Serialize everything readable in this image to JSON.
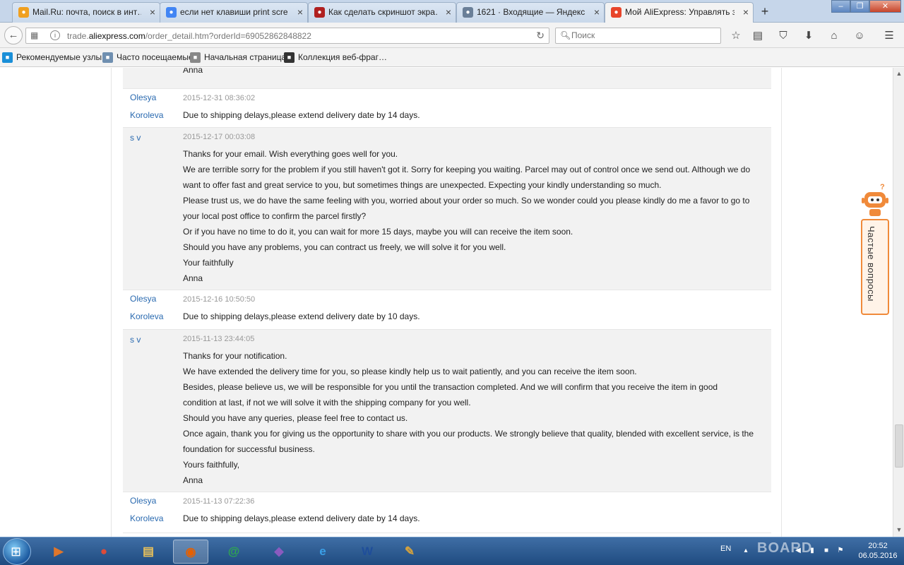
{
  "browser": {
    "tabs": [
      {
        "label": "Mail.Ru: почта, поиск в инт…",
        "icon": "mailru-icon",
        "color": "#f0a020"
      },
      {
        "label": "если нет клавиши print scre…",
        "icon": "google-icon",
        "color": "#4285f4"
      },
      {
        "label": "Как сделать скриншот экра…",
        "icon": "site-icon",
        "color": "#b02020"
      },
      {
        "label": "1621 · Входящие — Яндекс…",
        "icon": "mail-icon",
        "color": "#6a7f98"
      },
      {
        "label": "Мой AliExpress: Управлять з…",
        "icon": "aliexpress-icon",
        "color": "#e8452b"
      }
    ],
    "url_prefix": "trade.",
    "url_domain": "aliexpress.com",
    "url_path": "/order_detail.htm?orderId=69052862848822",
    "search_placeholder": "Поиск",
    "bookmarks": [
      {
        "label": "Рекомендуемые узлы",
        "icon": "bing-icon",
        "color": "#1a8fd8"
      },
      {
        "label": "Часто посещаемые",
        "icon": "folder-icon",
        "color": "#6f8fb0"
      },
      {
        "label": "Начальная страница",
        "icon": "firefox-home-icon",
        "color": "#888888"
      },
      {
        "label": "Коллекция веб-фраг…",
        "icon": "webslice-icon",
        "color": "#333333"
      }
    ]
  },
  "messages": [
    {
      "role": "seller",
      "author": "",
      "date": "",
      "lines": [
        "Anna"
      ]
    },
    {
      "role": "buyer",
      "author": "Olesya Koroleva",
      "date": "2015-12-31 08:36:02",
      "lines": [
        "Due to shipping delays,please extend delivery date by 14 days."
      ]
    },
    {
      "role": "seller",
      "author": "s v",
      "date": "2015-12-17 00:03:08",
      "lines": [
        "Thanks for your email. Wish everything goes well for you.",
        "We are terrible sorry for the problem if you still haven't got it. Sorry for keeping you waiting. Parcel may out of control once we send out. Although we do",
        "want to offer fast and great service to you, but sometimes things are unexpected. Expecting your kindly understanding so much.",
        "Please trust us, we do have the same feeling with you, worried about your order so much. So we wonder could you please kindly do me a favor to go to",
        "your local post office to confirm the parcel firstly?",
        "Or if you have no time to do it, you can wait for more 15 days, maybe you will can receive the item soon.",
        "Should you have any problems, you can contract us freely, we will solve it for you well.",
        "Your faithfully",
        "Anna"
      ]
    },
    {
      "role": "buyer",
      "author": "Olesya Koroleva",
      "date": "2015-12-16 10:50:50",
      "lines": [
        "Due to shipping delays,please extend delivery date by 10 days."
      ]
    },
    {
      "role": "seller",
      "author": "s v",
      "date": "2015-11-13 23:44:05",
      "lines": [
        "Thanks for your notification.",
        "We have extended the delivery time for you, so please kindly help us to wait patiently, and you can receive the item soon.",
        "Besides, please believe us, we will be responsible for you until the transaction completed. And we will confirm that you receive the item in good",
        "condition at last, if not we will solve it with the shipping company for you well.",
        "Should you have any queries, please feel free to contact us.",
        "Once again, thank you for giving us the opportunity to share with you our products. We strongly believe that quality, blended with excellent service, is the",
        "foundation for successful business.",
        "Yours faithfully,",
        "Anna"
      ]
    },
    {
      "role": "buyer",
      "author": "Olesya Koroleva",
      "date": "2015-11-13 07:22:36",
      "lines": [
        "Due to shipping delays,please extend delivery date by 14 days."
      ]
    }
  ],
  "faq": {
    "label": "Частые вопросы",
    "accent": "#f08a3a"
  },
  "taskbar": {
    "apps": [
      {
        "name": "media-player-icon",
        "glyph": "▶",
        "color": "#e0762a"
      },
      {
        "name": "chrome-icon",
        "glyph": "●",
        "color": "#dd4b39"
      },
      {
        "name": "explorer-icon",
        "glyph": "▤",
        "color": "#e8c05a"
      },
      {
        "name": "firefox-icon",
        "glyph": "◉",
        "color": "#e66000",
        "active": true
      },
      {
        "name": "mailru-agent-icon",
        "glyph": "@",
        "color": "#2fa84f"
      },
      {
        "name": "visual-studio-icon",
        "glyph": "◆",
        "color": "#8a5bbf"
      },
      {
        "name": "internet-explorer-icon",
        "glyph": "e",
        "color": "#3aa0e8"
      },
      {
        "name": "word-icon",
        "glyph": "W",
        "color": "#1f4e9a"
      },
      {
        "name": "paint-icon",
        "glyph": "✎",
        "color": "#d6a23c"
      }
    ],
    "lang": "EN",
    "watermark": "BOARD",
    "time": "20:52",
    "date": "06.05.2016"
  }
}
